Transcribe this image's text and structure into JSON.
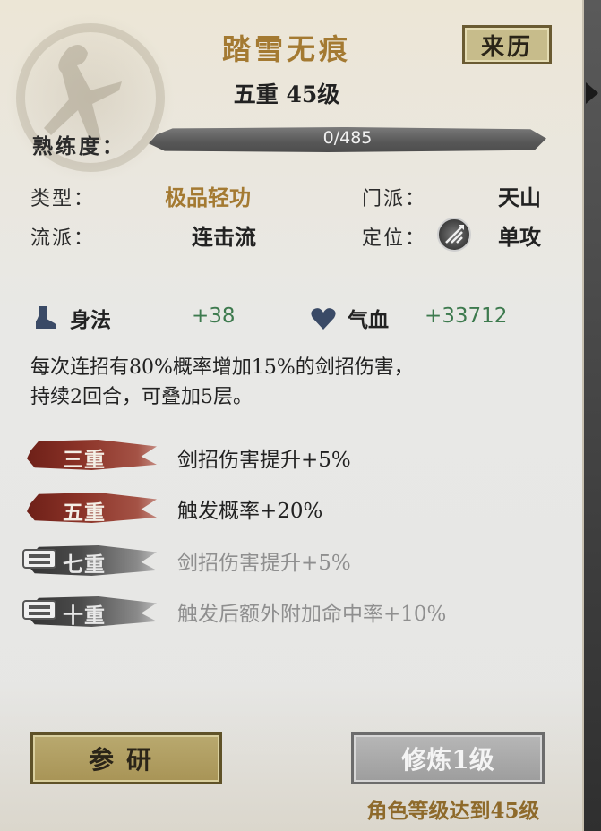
{
  "skill": {
    "title": "踏雪无痕",
    "level_text": "五重 45级",
    "origin_button": "来历"
  },
  "proficiency": {
    "label": "熟练度：",
    "value_text": "0/485",
    "fraction": 0
  },
  "info": {
    "type_label": "类型：",
    "type_value": "极品轻功",
    "school_label": "门派：",
    "school_value": "天山",
    "style_label": "流派：",
    "style_value": "连击流",
    "role_label": "定位：",
    "role_value": "单攻",
    "role_icon": "single-attack-icon"
  },
  "stats": [
    {
      "icon": "boot-icon",
      "label": "身法",
      "value": "+38"
    },
    {
      "icon": "heart-icon",
      "label": "气血",
      "value": "+33712"
    }
  ],
  "description_line1": "每次连招有80%概率增加15%的剑招伤害，",
  "description_line2": "持续2回合，可叠加5层。",
  "tiers": [
    {
      "label": "三重",
      "effect": "剑招伤害提升+5%",
      "locked": false
    },
    {
      "label": "五重",
      "effect": "触发概率+20%",
      "locked": false
    },
    {
      "label": "七重",
      "effect": "剑招伤害提升+5%",
      "locked": true
    },
    {
      "label": "十重",
      "effect": "触发后额外附加命中率+10%",
      "locked": true
    }
  ],
  "buttons": {
    "research": "参研",
    "train": "修炼1级"
  },
  "requirement": "角色等级达到45级",
  "colors": {
    "title_gold": "#a47a32",
    "stat_green": "#3d7a4e",
    "tier_red": "#8a3227",
    "locked_gray": "#8f8f8f"
  }
}
